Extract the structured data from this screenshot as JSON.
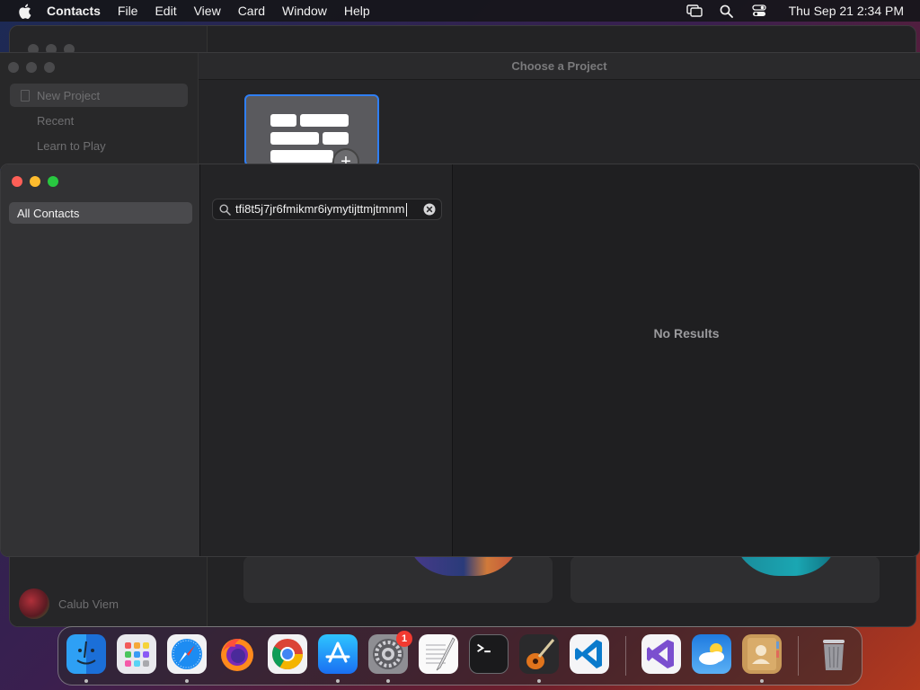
{
  "menubar": {
    "app_name": "Contacts",
    "items": [
      "File",
      "Edit",
      "View",
      "Card",
      "Window",
      "Help"
    ],
    "clock": "Thu Sep 21  2:34 PM"
  },
  "background_windows": {
    "project_chooser": {
      "title": "Choose a Project",
      "sidebar_items": [
        "New Project",
        "Recent",
        "Learn to Play"
      ]
    },
    "user_name": "Calub Viem"
  },
  "contacts": {
    "sidebar": {
      "selected_group": "All Contacts"
    },
    "search": {
      "value": "tfi8t5j7jr6fmikmr6iymytijttmjtmnm"
    },
    "add_label": "+",
    "empty_state": "No Results"
  },
  "dock": {
    "apps": [
      "finder",
      "launchpad",
      "safari",
      "firefox",
      "chrome",
      "app-store",
      "system-settings",
      "textedit",
      "terminal",
      "garageband",
      "vscode",
      "visual-studio",
      "weather",
      "contacts",
      "trash"
    ],
    "system_settings_badge": "1"
  },
  "colors": {
    "accent": "#2f7ff6",
    "close": "#fe5f57",
    "minimize": "#febc2e",
    "zoom": "#28c840",
    "badge": "#f23a30"
  }
}
